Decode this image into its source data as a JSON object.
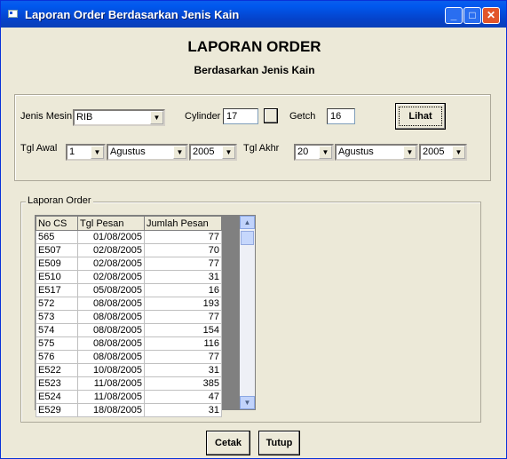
{
  "window": {
    "title": "Laporan Order Berdasarkan Jenis Kain",
    "min_label": "_",
    "max_label": "□",
    "close_label": "✕"
  },
  "heading": {
    "title": "LAPORAN ORDER",
    "subtitle": "Berdasarkan Jenis Kain"
  },
  "filter": {
    "jenis_mesin_label": "Jenis Mesin",
    "jenis_mesin_value": "RIB",
    "cylinder_label": "Cylinder",
    "cylinder_value": "17",
    "getch_label": "Getch",
    "getch_value": "16",
    "lihat_label": "Lihat",
    "tgl_awal_label": "Tgl Awal",
    "tgl_awal_day": "1",
    "tgl_awal_month": "Agustus",
    "tgl_awal_year": "2005",
    "tgl_akhir_label": "Tgl Akhr",
    "tgl_akhir_day": "20",
    "tgl_akhir_month": "Agustus",
    "tgl_akhir_year": "2005"
  },
  "report": {
    "frame_label": "Laporan Order",
    "columns": [
      "No CS",
      "Tgl Pesan",
      "Jumlah Pesan"
    ],
    "rows": [
      [
        "565",
        "01/08/2005",
        "77"
      ],
      [
        "E507",
        "02/08/2005",
        "70"
      ],
      [
        "E509",
        "02/08/2005",
        "77"
      ],
      [
        "E510",
        "02/08/2005",
        "31"
      ],
      [
        "E517",
        "05/08/2005",
        "16"
      ],
      [
        "572",
        "08/08/2005",
        "193"
      ],
      [
        "573",
        "08/08/2005",
        "77"
      ],
      [
        "574",
        "08/08/2005",
        "154"
      ],
      [
        "575",
        "08/08/2005",
        "116"
      ],
      [
        "576",
        "08/08/2005",
        "77"
      ],
      [
        "E522",
        "10/08/2005",
        "31"
      ],
      [
        "E523",
        "11/08/2005",
        "385"
      ],
      [
        "E524",
        "11/08/2005",
        "47"
      ],
      [
        "E529",
        "18/08/2005",
        "31"
      ]
    ]
  },
  "actions": {
    "cetak_label": "Cetak",
    "tutup_label": "Tutup"
  },
  "colors": {
    "titlebar": "#0058ee",
    "face": "#ece9d8",
    "close": "#e2552a"
  },
  "icons": [
    "app-icon",
    "dropdown-arrow-icon",
    "scroll-up-icon",
    "scroll-down-icon"
  ]
}
